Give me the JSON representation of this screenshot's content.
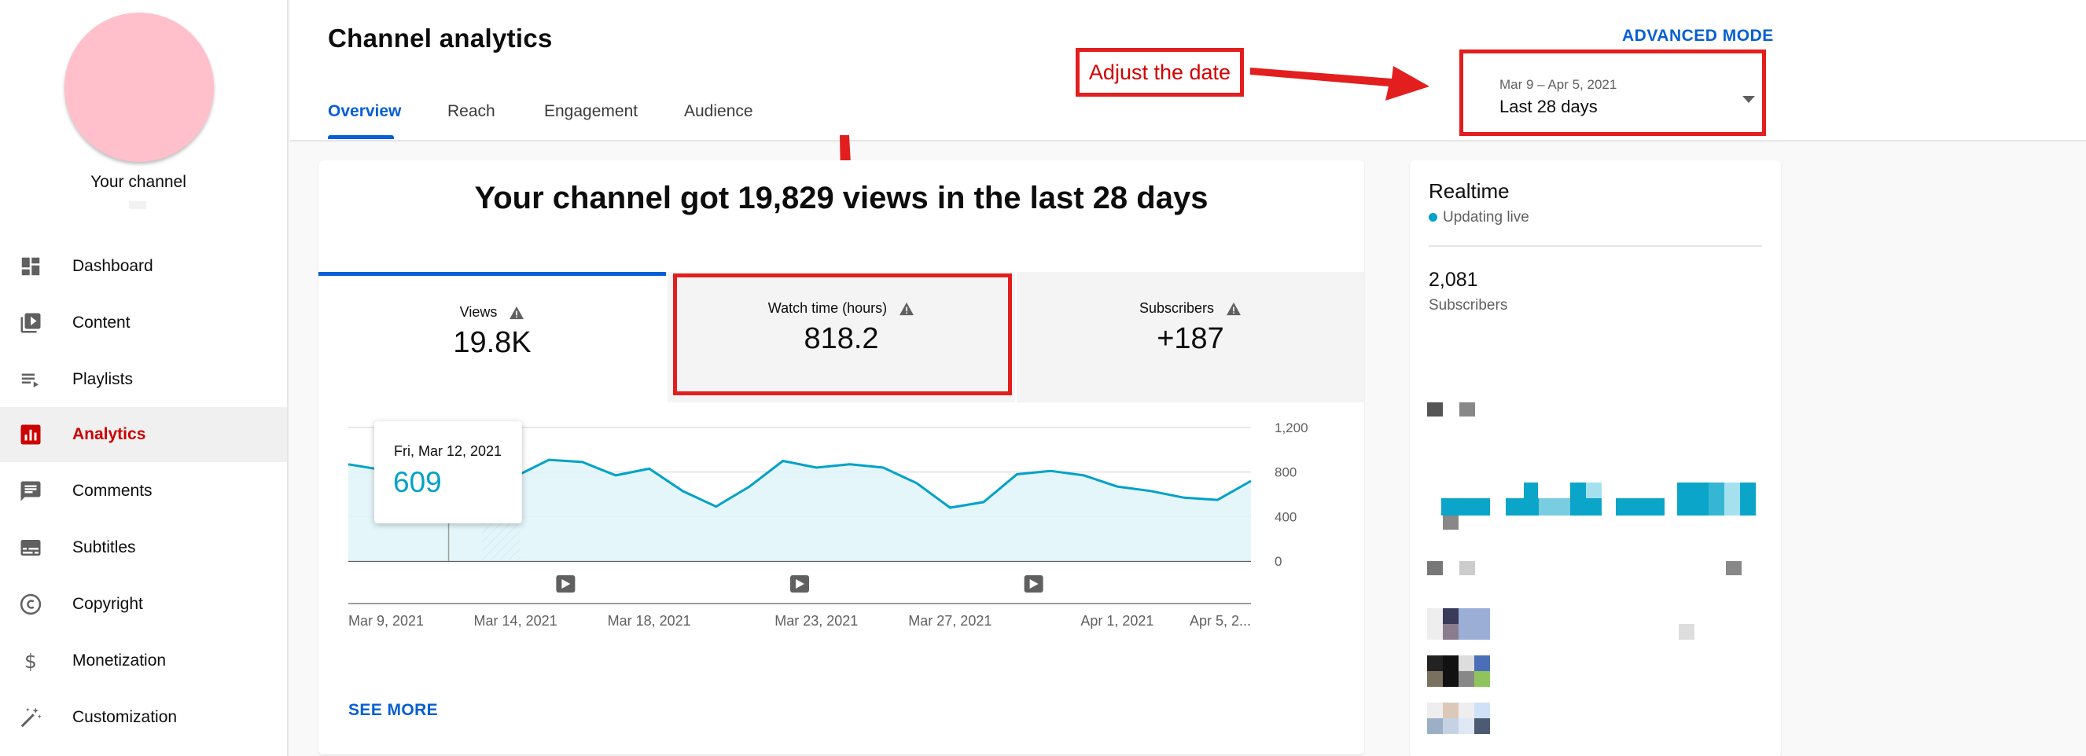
{
  "sidebar": {
    "channel_label": "Your channel",
    "items": [
      {
        "label": "Dashboard",
        "icon": "dashboard-icon",
        "active": false
      },
      {
        "label": "Content",
        "icon": "content-icon",
        "active": false
      },
      {
        "label": "Playlists",
        "icon": "playlists-icon",
        "active": false
      },
      {
        "label": "Analytics",
        "icon": "analytics-icon",
        "active": true
      },
      {
        "label": "Comments",
        "icon": "comments-icon",
        "active": false
      },
      {
        "label": "Subtitles",
        "icon": "subtitles-icon",
        "active": false
      },
      {
        "label": "Copyright",
        "icon": "copyright-icon",
        "active": false
      },
      {
        "label": "Monetization",
        "icon": "monetization-icon",
        "active": false
      },
      {
        "label": "Customization",
        "icon": "customization-icon",
        "active": false
      }
    ]
  },
  "header": {
    "title": "Channel analytics",
    "advanced_mode": "ADVANCED MODE",
    "tabs": [
      {
        "label": "Overview",
        "active": true
      },
      {
        "label": "Reach",
        "active": false
      },
      {
        "label": "Engagement",
        "active": false
      },
      {
        "label": "Audience",
        "active": false
      }
    ]
  },
  "date_picker": {
    "range": "Mar 9 – Apr 5, 2021",
    "value": "Last 28 days"
  },
  "annotation": {
    "label": "Adjust the date"
  },
  "summary": {
    "headline": "Your channel got 19,829 views in the last 28 days",
    "metrics": [
      {
        "label": "Views",
        "value": "19.8K",
        "active": true
      },
      {
        "label": "Watch time (hours)",
        "value": "818.2",
        "active": false
      },
      {
        "label": "Subscribers",
        "value": "+187",
        "active": false
      }
    ],
    "see_more": "SEE MORE"
  },
  "tooltip": {
    "date": "Fri, Mar 12, 2021",
    "value": "609"
  },
  "chart_data": {
    "type": "area",
    "x": [
      "Mar 9",
      "Mar 10",
      "Mar 11",
      "Mar 12",
      "Mar 13",
      "Mar 14",
      "Mar 15",
      "Mar 16",
      "Mar 17",
      "Mar 18",
      "Mar 19",
      "Mar 20",
      "Mar 21",
      "Mar 22",
      "Mar 23",
      "Mar 24",
      "Mar 25",
      "Mar 26",
      "Mar 27",
      "Mar 28",
      "Mar 29",
      "Mar 30",
      "Mar 31",
      "Apr 1",
      "Apr 2",
      "Apr 3",
      "Apr 4",
      "Apr 5"
    ],
    "values": [
      870,
      820,
      720,
      609,
      490,
      760,
      910,
      890,
      770,
      830,
      630,
      490,
      670,
      900,
      840,
      870,
      840,
      700,
      480,
      530,
      780,
      810,
      770,
      670,
      630,
      570,
      550,
      720
    ],
    "xtick_labels": [
      "Mar 9, 2021",
      "Mar 14, 2021",
      "Mar 18, 2021",
      "Mar 23, 2021",
      "Mar 27, 2021",
      "Apr 1, 2021",
      "Apr 5, 2..."
    ],
    "xtick_indices": [
      0,
      5,
      9,
      14,
      18,
      23,
      27
    ],
    "yticks": [
      0,
      400,
      800,
      1200
    ],
    "ytick_labels": [
      "0",
      "400",
      "800",
      "1,200"
    ],
    "ylim": [
      0,
      1200
    ],
    "highlight_index": 3,
    "hatched_range": [
      4,
      5
    ],
    "video_markers": [
      6,
      13,
      20
    ],
    "line_color": "#00a2c7",
    "fill_color": "#e1f5f9"
  },
  "realtime": {
    "title": "Realtime",
    "status": "Updating live",
    "count": "2,081",
    "count_label": "Subscribers"
  },
  "colors": {
    "accent": "#065fd4",
    "analytics_red": "#cc0000",
    "annotation_red": "#e21e1e",
    "chart_teal": "#00a2c7"
  }
}
